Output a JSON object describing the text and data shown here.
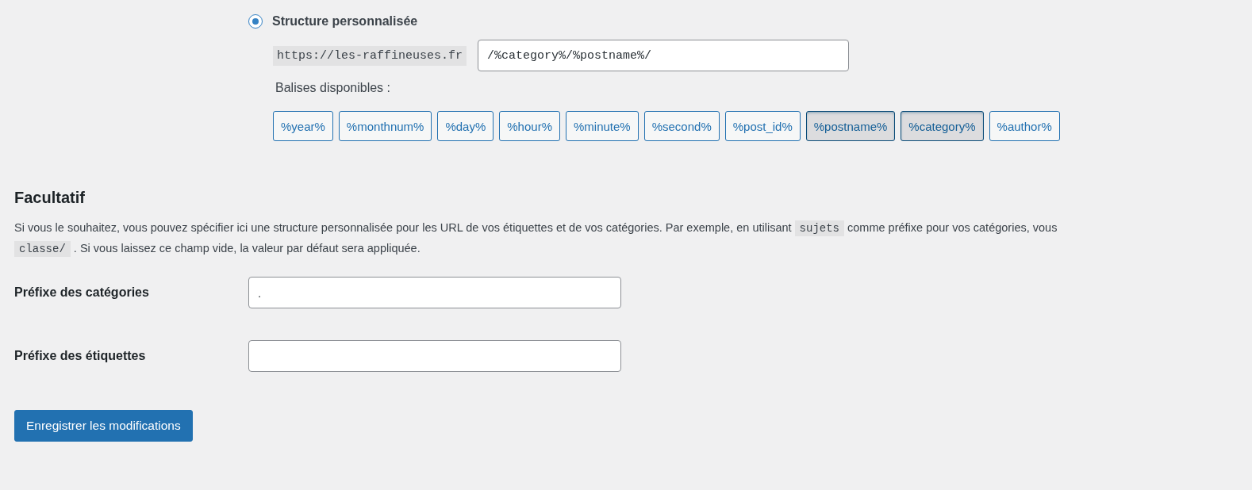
{
  "structure": {
    "label": "Structure personnalisée",
    "checked": true,
    "base_url": "https://les-raffineuses.fr",
    "value": "/%category%/%postname%/"
  },
  "tags_label": "Balises disponibles :",
  "tags": [
    {
      "label": "%year%",
      "selected": false
    },
    {
      "label": "%monthnum%",
      "selected": false
    },
    {
      "label": "%day%",
      "selected": false
    },
    {
      "label": "%hour%",
      "selected": false
    },
    {
      "label": "%minute%",
      "selected": false
    },
    {
      "label": "%second%",
      "selected": false
    },
    {
      "label": "%post_id%",
      "selected": false
    },
    {
      "label": "%postname%",
      "selected": true
    },
    {
      "label": "%category%",
      "selected": true
    },
    {
      "label": "%author%",
      "selected": false
    }
  ],
  "optional": {
    "title": "Facultatif",
    "lines": [
      [
        {
          "kind": "text",
          "text": "Si vous le souhaitez, vous pouvez spécifier ici une structure personnalisée pour les URL de vos étiquettes et de vos catégories. Par exemple, en utilisant"
        },
        {
          "kind": "code",
          "text": "sujets"
        },
        {
          "kind": "text",
          "text": "comme préfixe pour vos catégories, vous"
        }
      ],
      [
        {
          "kind": "code",
          "text": "classe/"
        },
        {
          "kind": "text",
          "text": ". Si vous laissez ce champ vide, la valeur par défaut sera appliquée."
        }
      ]
    ]
  },
  "fields": [
    {
      "label": "Préfixe des catégories",
      "value": "."
    },
    {
      "label": "Préfixe des étiquettes"
    }
  ],
  "submit": "Enregistrer les modifications"
}
